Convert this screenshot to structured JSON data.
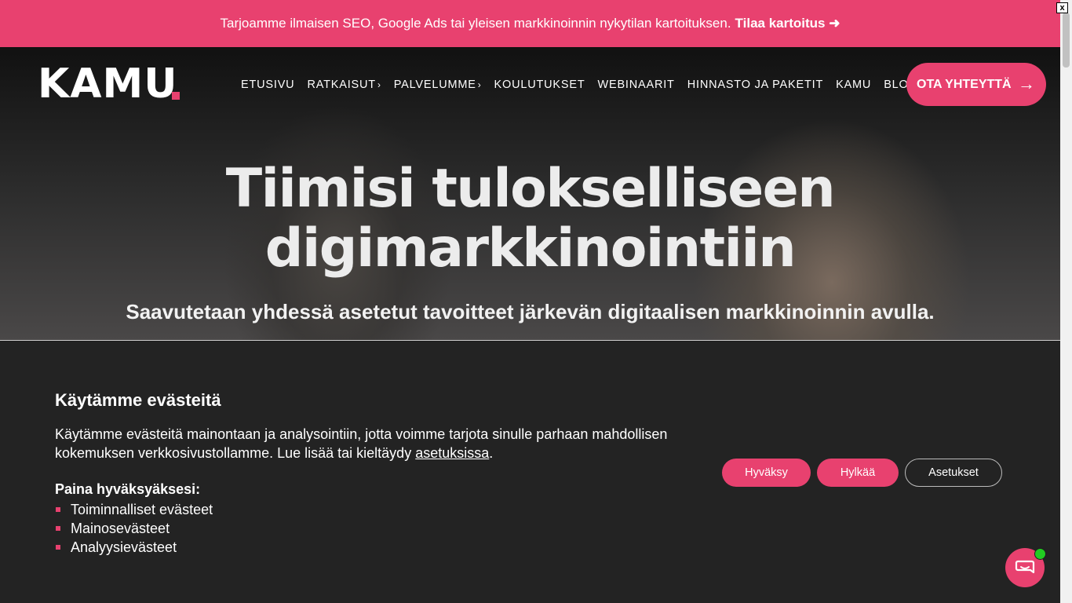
{
  "promo": {
    "text": "Tarjoamme ilmaisen SEO, Google Ads tai yleisen markkinoinnin nykytilan kartoituksen.",
    "cta": "Tilaa kartoitus ➜",
    "close": "x"
  },
  "header": {
    "logo": "KAMU",
    "nav": [
      "ETUSIVU",
      "RATKAISUT",
      "PALVELUMME",
      "KOULUTUKSET",
      "WEBINAARIT",
      "HINNASTO JA PAKETIT",
      "KAMU",
      "BLOGI"
    ],
    "cta": "OTA YHTEYTTÄ"
  },
  "hero": {
    "title_line1": "Tiimisi tulokselliseen",
    "title_line2": "digimarkkinointiin",
    "subtitle": "Saavutetaan yhdessä asetetut tavoitteet järkevän digitaalisen markkinoinnin avulla."
  },
  "cookie": {
    "title": "Käytämme evästeitä",
    "text_before_link": "Käytämme evästeitä mainontaan ja analysointiin, jotta voimme tarjota sinulle parhaan mahdollisen kokemuksen verkkosivustollamme. Lue lisää tai kieltäydy",
    "link": "asetuksissa",
    "text_after_link": ".",
    "list_title": "Paina hyväksyäksesi:",
    "list": [
      "Toiminnalliset evästeet",
      "Mainosevästeet",
      "Analyysievästeet"
    ],
    "accept": "Hyväksy",
    "reject": "Hylkää",
    "settings": "Asetukset"
  },
  "colors": {
    "accent": "#e8416f",
    "dark": "#232323",
    "online": "#22cc22"
  }
}
